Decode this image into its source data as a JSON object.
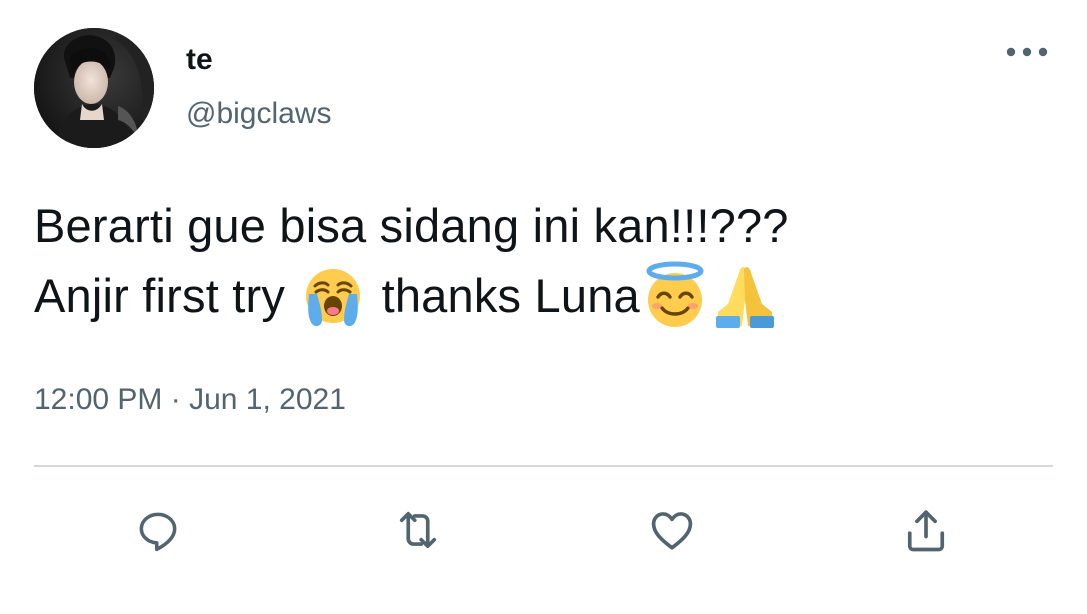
{
  "author": {
    "display_name": "te",
    "handle": "@bigclaws",
    "avatar_icon": "avatar-photo"
  },
  "tweet": {
    "text_line1": "Berarti gue bisa sidang ini kan!!!???",
    "text_line2_part1": "Anjir first try ",
    "text_line2_part2": " thanks Luna",
    "emojis": [
      "loudly-crying-face",
      "smiling-face-with-halo",
      "folded-hands"
    ],
    "time": "12:00 PM",
    "separator": " · ",
    "date": "Jun 1, 2021"
  },
  "actions": {
    "icons": [
      "reply-icon",
      "retweet-icon",
      "like-icon",
      "share-icon"
    ]
  },
  "colors": {
    "text": "#0f1419",
    "secondary": "#536471",
    "divider": "#d3d8dc",
    "icon": "#536471"
  }
}
